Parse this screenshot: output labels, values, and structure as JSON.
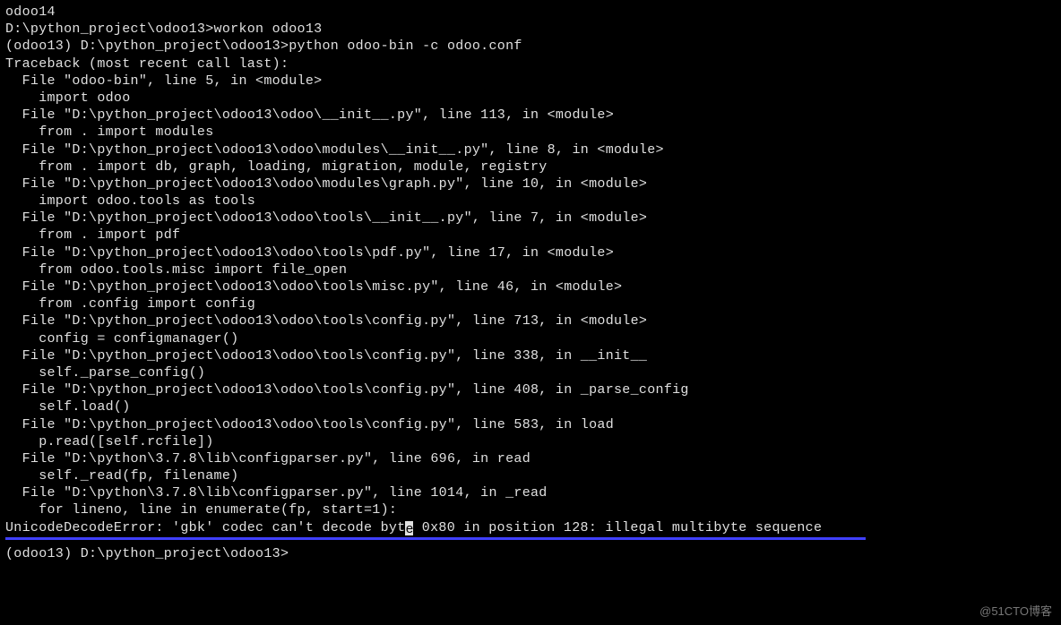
{
  "terminal": {
    "title_line": "odoo14",
    "blank_line": "",
    "lines": [
      "D:\\python_project\\odoo13>workon odoo13",
      "(odoo13) D:\\python_project\\odoo13>python odoo-bin -c odoo.conf",
      "Traceback (most recent call last):",
      "  File \"odoo-bin\", line 5, in <module>",
      "    import odoo",
      "  File \"D:\\python_project\\odoo13\\odoo\\__init__.py\", line 113, in <module>",
      "    from . import modules",
      "  File \"D:\\python_project\\odoo13\\odoo\\modules\\__init__.py\", line 8, in <module>",
      "    from . import db, graph, loading, migration, module, registry",
      "  File \"D:\\python_project\\odoo13\\odoo\\modules\\graph.py\", line 10, in <module>",
      "    import odoo.tools as tools",
      "  File \"D:\\python_project\\odoo13\\odoo\\tools\\__init__.py\", line 7, in <module>",
      "    from . import pdf",
      "  File \"D:\\python_project\\odoo13\\odoo\\tools\\pdf.py\", line 17, in <module>",
      "    from odoo.tools.misc import file_open",
      "  File \"D:\\python_project\\odoo13\\odoo\\tools\\misc.py\", line 46, in <module>",
      "    from .config import config",
      "  File \"D:\\python_project\\odoo13\\odoo\\tools\\config.py\", line 713, in <module>",
      "    config = configmanager()",
      "  File \"D:\\python_project\\odoo13\\odoo\\tools\\config.py\", line 338, in __init__",
      "    self._parse_config()",
      "  File \"D:\\python_project\\odoo13\\odoo\\tools\\config.py\", line 408, in _parse_config",
      "    self.load()",
      "  File \"D:\\python_project\\odoo13\\odoo\\tools\\config.py\", line 583, in load",
      "    p.read([self.rcfile])",
      "  File \"D:\\python\\3.7.8\\lib\\configparser.py\", line 696, in read",
      "    self._read(fp, filename)",
      "  File \"D:\\python\\3.7.8\\lib\\configparser.py\", line 1014, in _read",
      "    for lineno, line in enumerate(fp, start=1):"
    ],
    "error_line_before_cursor": "UnicodeDecodeError: 'gbk' codec can't decode byt",
    "error_line_cursor_char": "e",
    "error_line_after_cursor": " 0x80 in position 128: illegal multibyte sequence",
    "prompt_line": "(odoo13) D:\\python_project\\odoo13>",
    "watermark": "@51CTO博客"
  }
}
